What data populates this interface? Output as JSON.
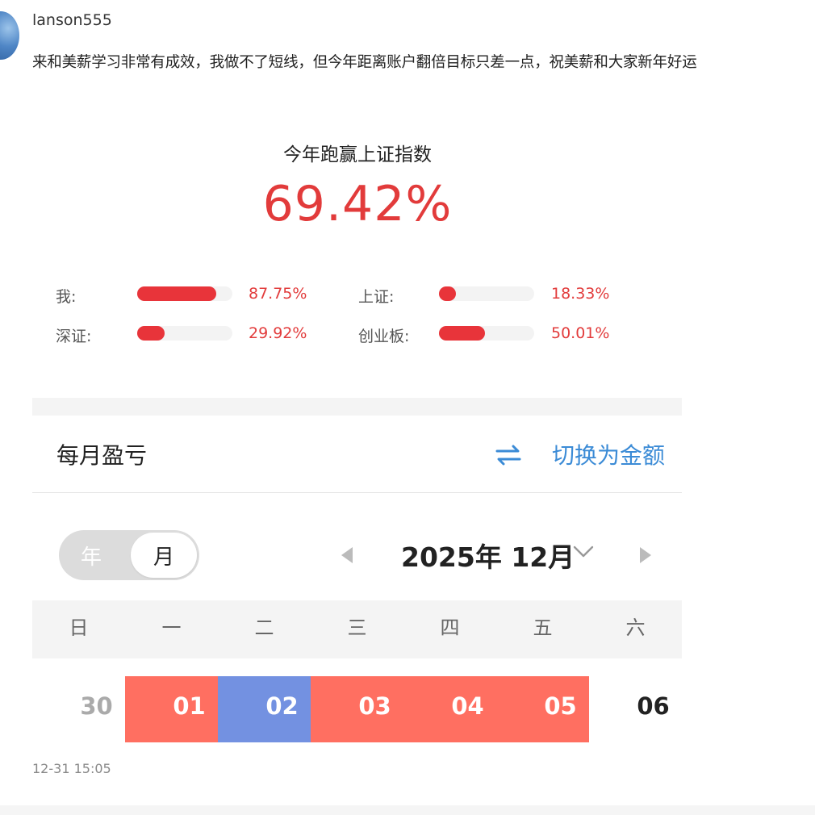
{
  "post": {
    "username": "lanson555",
    "comment": "来和美薪学习非常有成效，我做不了短线，但今年距离账户翻倍目标只差一点，祝美薪和大家新年好运",
    "timestamp": "12-31 15:05"
  },
  "summary": {
    "title": "今年跑赢上证指数",
    "value": "69.42%",
    "accent_color": "#e23b3b"
  },
  "stats": [
    {
      "label": "我:",
      "percent": "87.75%"
    },
    {
      "label": "上证:",
      "percent": "18.33%"
    },
    {
      "label": "深证:",
      "percent": "29.92%"
    },
    {
      "label": "创业板:",
      "percent": "50.01%"
    }
  ],
  "calendar": {
    "section_title": "每月盈亏",
    "switch_label": "切换为金额",
    "switch_icon": "swap-icon",
    "toggle": {
      "year": "年",
      "month": "月",
      "selected": "月"
    },
    "month_label": "2025年 12月",
    "weekdays": [
      "日",
      "一",
      "二",
      "三",
      "四",
      "五",
      "六"
    ],
    "days": [
      {
        "day": "30",
        "color": "#ffffff",
        "text_color": "#aaaaaa"
      },
      {
        "day": "01",
        "color": "#ff6f61",
        "text_color": "#ffffff"
      },
      {
        "day": "02",
        "color": "#7391e1",
        "text_color": "#ffffff"
      },
      {
        "day": "03",
        "color": "#ff6f61",
        "text_color": "#ffffff"
      },
      {
        "day": "04",
        "color": "#ff6f61",
        "text_color": "#ffffff"
      },
      {
        "day": "05",
        "color": "#ff6f61",
        "text_color": "#ffffff"
      },
      {
        "day": "06",
        "color": "#ffffff",
        "text_color": "#222222"
      }
    ]
  }
}
